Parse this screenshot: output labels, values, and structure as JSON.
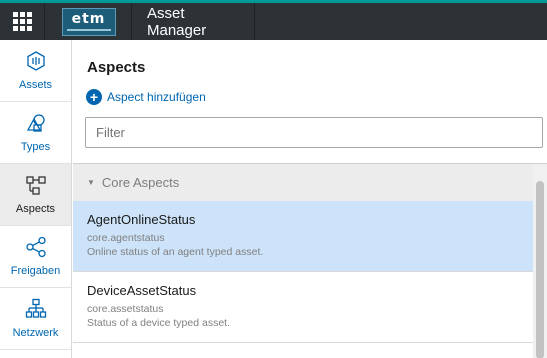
{
  "header": {
    "logo_text": "etm",
    "app_title": "Asset Manager"
  },
  "sidebar": {
    "items": [
      {
        "label": "Assets",
        "icon": "assets-icon",
        "active": false
      },
      {
        "label": "Types",
        "icon": "types-icon",
        "active": false
      },
      {
        "label": "Aspects",
        "icon": "aspects-icon",
        "active": true
      },
      {
        "label": "Freigaben",
        "icon": "share-icon",
        "active": false
      },
      {
        "label": "Netzwerk",
        "icon": "network-icon",
        "active": false
      }
    ]
  },
  "main": {
    "title": "Aspects",
    "add_label": "Aspect hinzufügen",
    "filter": {
      "placeholder": "Filter",
      "value": ""
    },
    "group": {
      "label": "Core Aspects",
      "expanded": true
    },
    "aspects": [
      {
        "name": "AgentOnlineStatus",
        "id": "core.agentstatus",
        "description": "Online status of an agent typed asset.",
        "selected": true
      },
      {
        "name": "DeviceAssetStatus",
        "id": "core.assetstatus",
        "description": "Status of a device typed asset.",
        "selected": false
      }
    ]
  },
  "colors": {
    "topbar": "#2d3236",
    "accent": "#009999",
    "link": "#0066b1",
    "selected_row": "#cde3f9"
  }
}
